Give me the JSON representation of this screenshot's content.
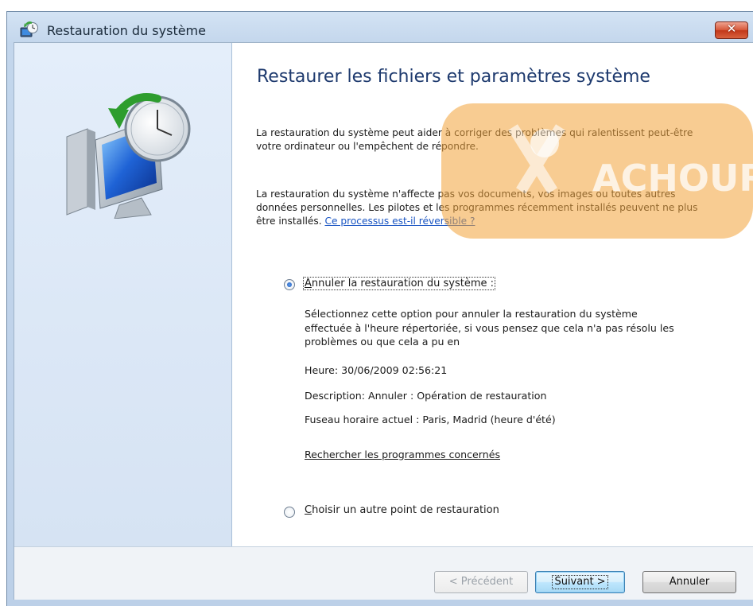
{
  "window": {
    "title": "Restauration du système",
    "close_glyph": "✕",
    "icon": "system-restore-icon"
  },
  "hero": {
    "icon": "system-restore-monitor-clock-icon"
  },
  "content": {
    "heading": "Restaurer les fichiers et paramètres système",
    "intro": "La restauration du système peut aider à corriger des problèmes qui ralentissent peut-être votre ordinateur ou l'empêchent de répondre.",
    "info": "La restauration du système n'affecte pas vos documents, vos images ou toutes autres données personnelles. Les pilotes et les programmes récemment installés peuvent ne plus être installés.",
    "info_link": "Ce processus est-il réversible ?"
  },
  "options": {
    "undo": {
      "label": "Annuler la restauration du système :",
      "selected": true,
      "description": "Sélectionnez cette option pour annuler la restauration du système effectuée à l'heure répertoriée, si vous pensez que cela n'a pas résolu les problèmes ou que cela a pu en",
      "time": "Heure: 30/06/2009 02:56:21",
      "desc_line": "Description: Annuler : Opération de restauration",
      "timezone": "Fuseau horaire actuel : Paris, Madrid (heure d'été)",
      "affected_link": "Rechercher les programmes concernés"
    },
    "other": {
      "label": "Choisir un autre point de restauration",
      "selected": false
    }
  },
  "buttons": {
    "previous": "< Précédent",
    "next": "Suivant >",
    "cancel": "Annuler"
  },
  "watermark": {
    "text": "ACHOURI",
    "color": "#f0a020"
  }
}
